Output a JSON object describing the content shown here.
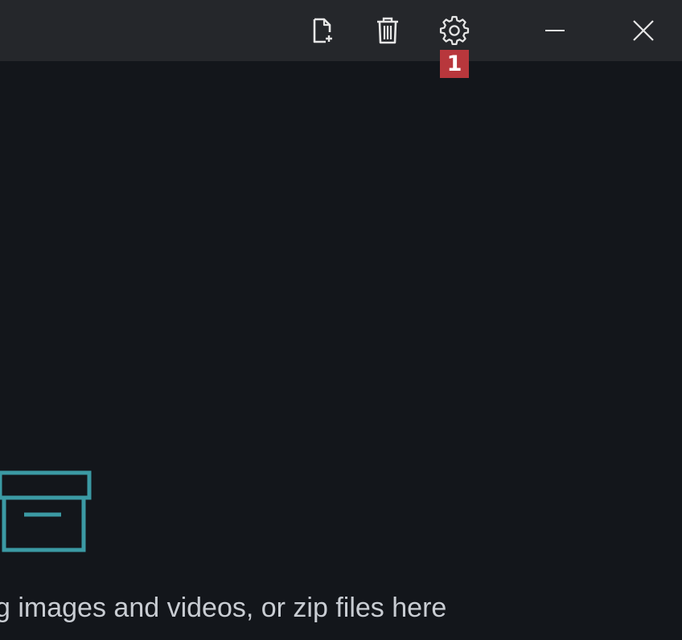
{
  "titlebar": {
    "buttons": [
      {
        "name": "new-file-icon"
      },
      {
        "name": "trash-icon"
      },
      {
        "name": "gear-icon"
      },
      {
        "name": "minimize-icon"
      },
      {
        "name": "close-icon"
      }
    ],
    "settings_badge": "1"
  },
  "dropzone": {
    "icon": "archive-box-icon",
    "text": "g images and videos, or zip files here"
  },
  "colors": {
    "background": "#13161b",
    "titlebar": "#25272b",
    "icon": "#e6e6e6",
    "accent": "#3b9aa4",
    "badge": "#b8373c",
    "text": "#c9cdd3"
  }
}
